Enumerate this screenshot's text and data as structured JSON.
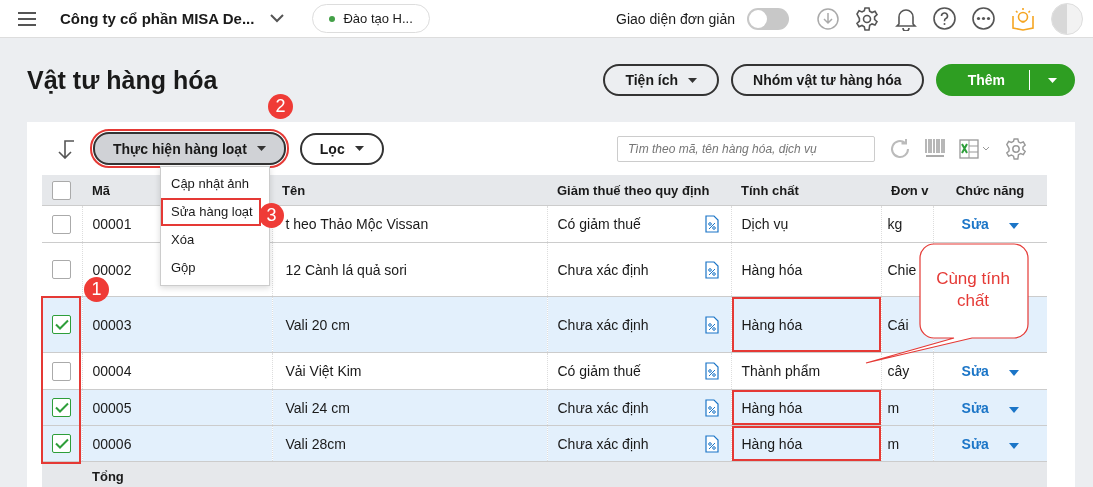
{
  "topbar": {
    "company": "Công ty cổ phần MISA De...",
    "branch": "Đào tạo H...",
    "simple_mode": {
      "label": "Giao diện đơn giản",
      "on": false
    }
  },
  "page": {
    "title": "Vật tư hàng hóa",
    "buttons": [
      {
        "label": "Tiện ích",
        "kind": "dropdown"
      },
      {
        "label": "Nhóm vật tư hàng hóa",
        "kind": "plain"
      },
      {
        "label": "Thêm",
        "kind": "split"
      }
    ]
  },
  "toolbar": {
    "bulk_button": {
      "label": "Thực hiện hàng loạt",
      "marked": true
    },
    "filter_button": "Lọc",
    "search": {
      "placeholder": "Tìm theo mã, tên hàng hóa, dịch vụ"
    }
  },
  "bulk_menu": {
    "items": [
      {
        "label": "Cập nhật ảnh",
        "marked": false
      },
      {
        "label": "Sửa hàng loạt",
        "marked": true
      },
      {
        "label": "Xóa",
        "marked": false
      },
      {
        "label": "Gộp",
        "marked": false
      }
    ]
  },
  "table": {
    "columns": [
      "Mã",
      "Tên",
      "Giảm thuế theo quy định",
      "Tính chất",
      "Đơn v",
      "Chức năng"
    ],
    "all_checked": false,
    "rows": [
      {
        "checked": false,
        "code": "00001",
        "name": "t heo Thảo Mộc Vissan",
        "tax": "Có giảm thuế",
        "nature": "Dịch vụ",
        "nature_marked": false,
        "unit": "kg",
        "action": "Sửa"
      },
      {
        "checked": false,
        "code": "00002",
        "name": "12 Cành lá quả sori",
        "tax": "Chưa xác định",
        "nature": "Hàng hóa",
        "nature_marked": false,
        "unit": "Chie"
      },
      {
        "checked": true,
        "code": "00003",
        "name": "Vali 20 cm",
        "tax": "Chưa xác định",
        "nature": "Hàng hóa",
        "nature_marked": true,
        "unit": "Cái"
      },
      {
        "checked": false,
        "code": "00004",
        "name": "Vải Việt Kim",
        "tax": "Có giảm thuế",
        "nature": "Thành phẩm",
        "nature_marked": false,
        "unit": "cây",
        "action": "Sửa"
      },
      {
        "checked": true,
        "code": "00005",
        "name": "Vali 24 cm",
        "tax": "Chưa xác định",
        "nature": "Hàng hóa",
        "nature_marked": true,
        "unit": "m",
        "action": "Sửa"
      },
      {
        "checked": true,
        "code": "00006",
        "name": "Vali 28cm",
        "tax": "Chưa xác định",
        "nature": "Hàng hóa",
        "nature_marked": true,
        "unit": "m",
        "action": "Sửa"
      }
    ],
    "footer": "Tổng"
  },
  "annotations": {
    "badges": [
      "1",
      "2",
      "3"
    ],
    "callout": "Cùng tính chất"
  }
}
